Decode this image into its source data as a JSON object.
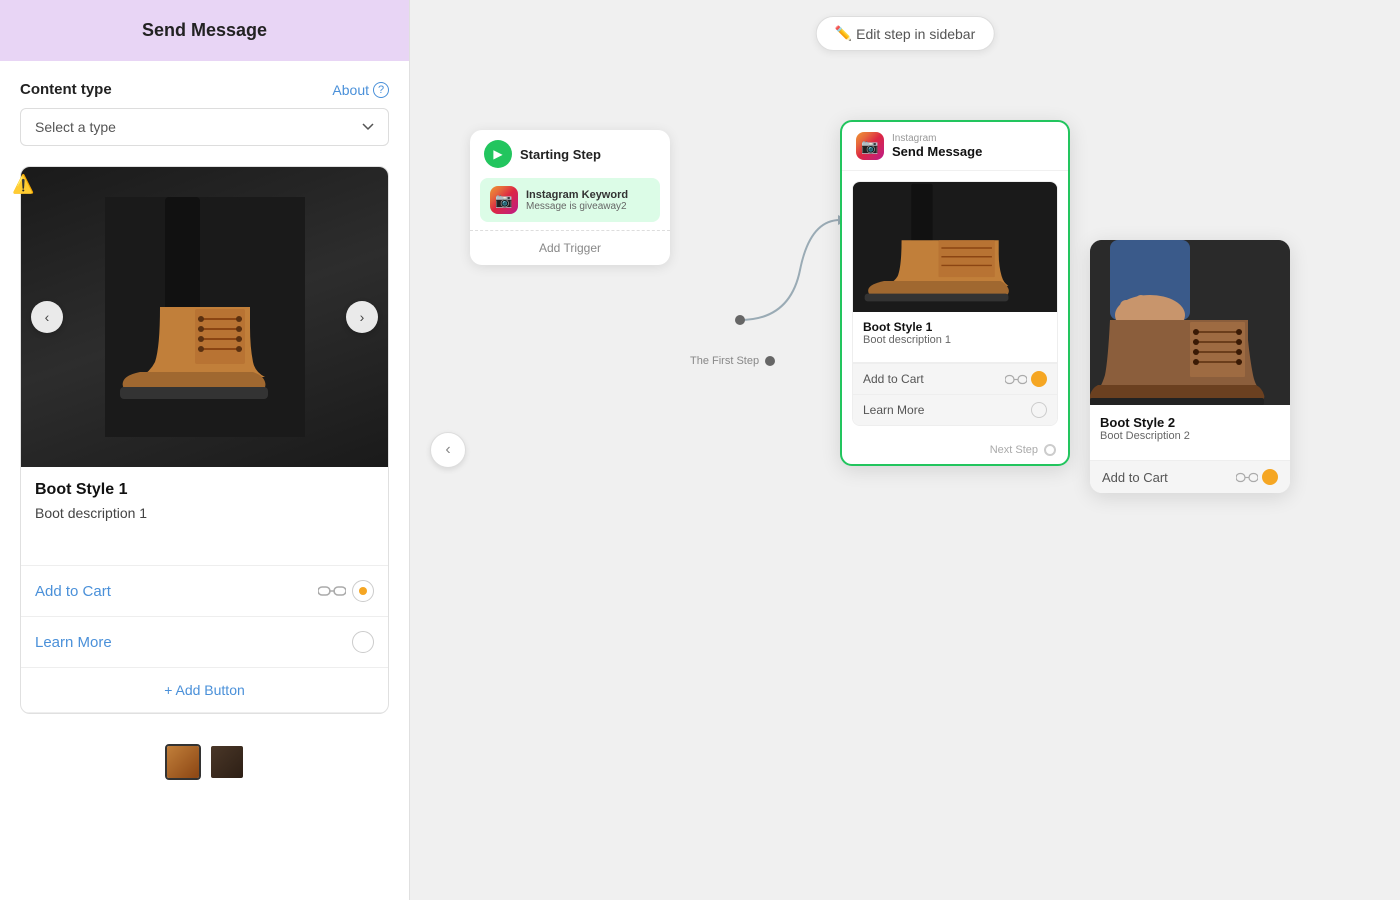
{
  "sidebar": {
    "header_title": "Send Message",
    "content_type_label": "Content type",
    "about_label": "About",
    "select_placeholder": "Select a type",
    "card1": {
      "title": "Boot Style 1",
      "description": "Boot description 1",
      "btn1_label": "Add to Cart",
      "btn2_label": "Learn More",
      "add_button_label": "+ Add Button"
    }
  },
  "canvas": {
    "edit_step_label": "✏️ Edit step in sidebar",
    "starting_step_title": "Starting Step",
    "instagram_keyword_title": "Instagram Keyword",
    "instagram_keyword_sub": "Message is giveaway2",
    "add_trigger_label": "Add Trigger",
    "first_step_label": "The First Step",
    "send_message_platform": "Instagram",
    "send_message_title": "Send Message",
    "node_card1_title": "Boot Style 1",
    "node_card1_desc": "Boot description 1",
    "node_btn1": "Add to Cart",
    "node_btn2": "Learn More",
    "next_step_label": "Next Step",
    "card2_title": "Boot Style 2",
    "card2_desc": "Boot Description 2",
    "card2_btn": "Add to Cart"
  }
}
